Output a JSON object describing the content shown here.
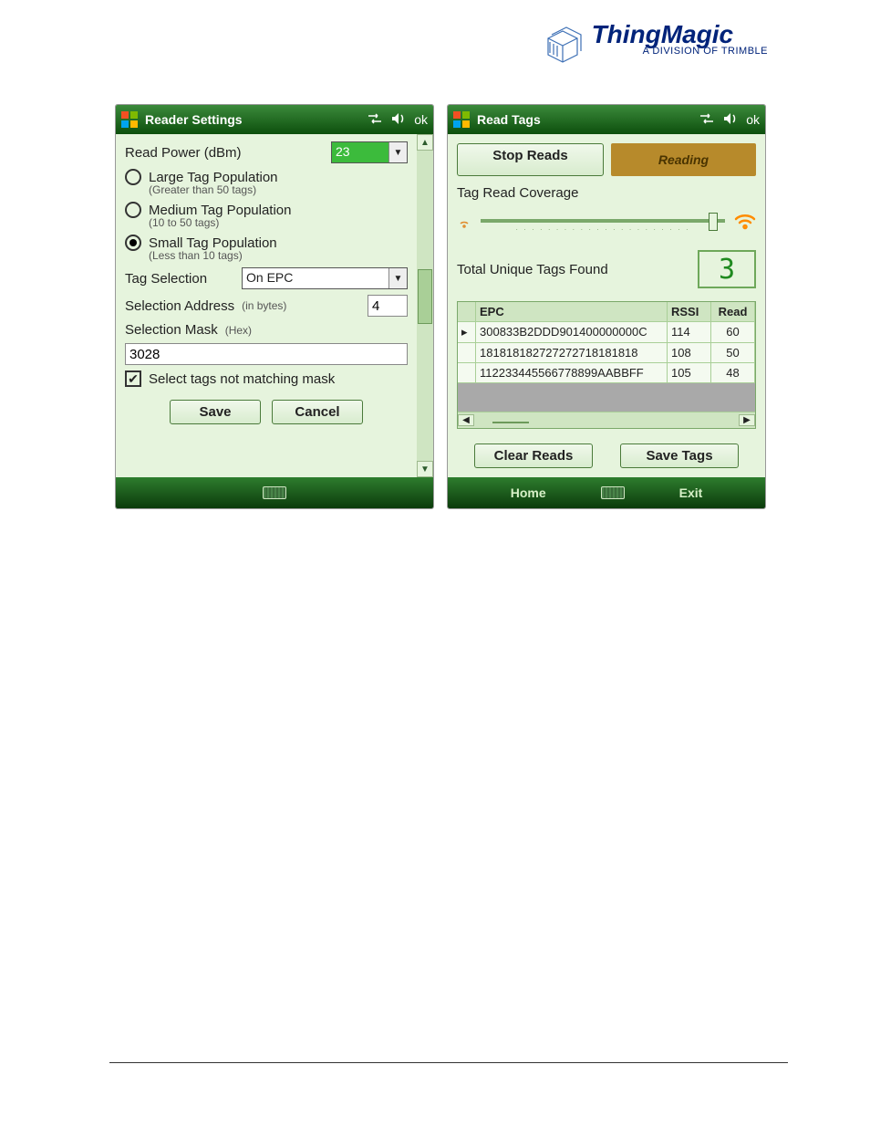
{
  "logo": {
    "name": "ThingMagic",
    "subtitle": "A DIVISION OF TRIMBLE"
  },
  "left": {
    "title": "Reader Settings",
    "ok": "ok",
    "readPowerLabel": "Read Power (dBm)",
    "readPowerValue": "23",
    "popOptions": {
      "large": {
        "label": "Large Tag Population",
        "hint": "(Greater than 50 tags)"
      },
      "medium": {
        "label": "Medium Tag Population",
        "hint": "(10 to 50 tags)"
      },
      "small": {
        "label": "Small Tag Population",
        "hint": "(Less than 10 tags)"
      }
    },
    "tagSelectionLabel": "Tag Selection",
    "tagSelectionValue": "On EPC",
    "selAddrLabel": "Selection Address",
    "selAddrHint": "(in bytes)",
    "selAddrValue": "4",
    "selMaskLabel": "Selection Mask",
    "selMaskHint": "(Hex)",
    "selMaskValue": "3028",
    "notMatchLabel": "Select tags not matching mask",
    "saveLabel": "Save",
    "cancelLabel": "Cancel"
  },
  "right": {
    "title": "Read Tags",
    "ok": "ok",
    "stopReadsLabel": "Stop Reads",
    "status": "Reading",
    "coverageLabel": "Tag Read Coverage",
    "totalLabel": "Total Unique Tags Found",
    "totalValue": "3",
    "columns": {
      "epc": "EPC",
      "rssi": "RSSI",
      "read": "Read"
    },
    "rows": [
      {
        "epc": "300833B2DDD901400000000C",
        "rssi": "114",
        "read": "60"
      },
      {
        "epc": "181818182727272718181818",
        "rssi": "108",
        "read": "50"
      },
      {
        "epc": "112233445566778899AABBFF",
        "rssi": "105",
        "read": "48"
      }
    ],
    "clearReadsLabel": "Clear Reads",
    "saveTagsLabel": "Save Tags",
    "homeLabel": "Home",
    "exitLabel": "Exit"
  }
}
